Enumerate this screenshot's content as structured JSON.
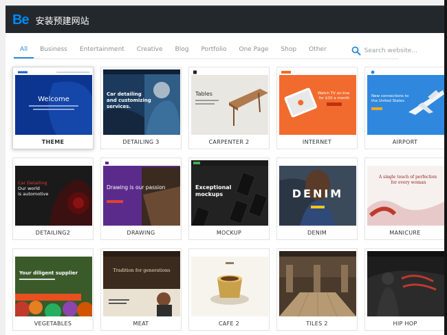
{
  "app": {
    "logo": "Be",
    "title": "安装预建网站"
  },
  "filters": [
    {
      "label": "All",
      "active": true
    },
    {
      "label": "Business"
    },
    {
      "label": "Entertainment"
    },
    {
      "label": "Creative"
    },
    {
      "label": "Blog"
    },
    {
      "label": "Portfolio"
    },
    {
      "label": "One Page"
    },
    {
      "label": "Shop"
    },
    {
      "label": "Other"
    }
  ],
  "search": {
    "placeholder": "Search website..."
  },
  "accent": "#2a8bd4",
  "sites": [
    {
      "label": "THEME",
      "selected": true,
      "thumb": {
        "headline": "Welcome"
      }
    },
    {
      "label": "DETAILING 3",
      "thumb": {
        "headline": "Car detailing and customizing services."
      }
    },
    {
      "label": "CARPENTER 2",
      "thumb": {
        "headline": "Tables"
      }
    },
    {
      "label": "INTERNET",
      "thumb": {
        "headline": "Watch TV on-line for $10 a month"
      }
    },
    {
      "label": "AIRPORT",
      "thumb": {
        "headline": "New connections to the United States"
      }
    },
    {
      "label": "DETAILING2",
      "thumb": {
        "headline": "Car Detailing Our world is automotive"
      }
    },
    {
      "label": "DRAWING",
      "thumb": {
        "headline": "Drawing is our passion"
      }
    },
    {
      "label": "MOCKUP",
      "thumb": {
        "headline": "Exceptional mockups"
      }
    },
    {
      "label": "DENIM",
      "thumb": {
        "headline": "DENIM"
      }
    },
    {
      "label": "MANICURE",
      "thumb": {
        "headline": "A single touch of perfection for every woman"
      }
    },
    {
      "label": "VEGETABLES",
      "thumb": {
        "headline": "Your diligent supplier"
      }
    },
    {
      "label": "MEAT",
      "thumb": {
        "headline": "Tradition for generations"
      }
    },
    {
      "label": "CAFE 2",
      "thumb": {
        "headline": ""
      }
    },
    {
      "label": "TILES 2",
      "thumb": {
        "headline": ""
      }
    },
    {
      "label": "HIP HOP",
      "thumb": {
        "headline": ""
      }
    }
  ]
}
